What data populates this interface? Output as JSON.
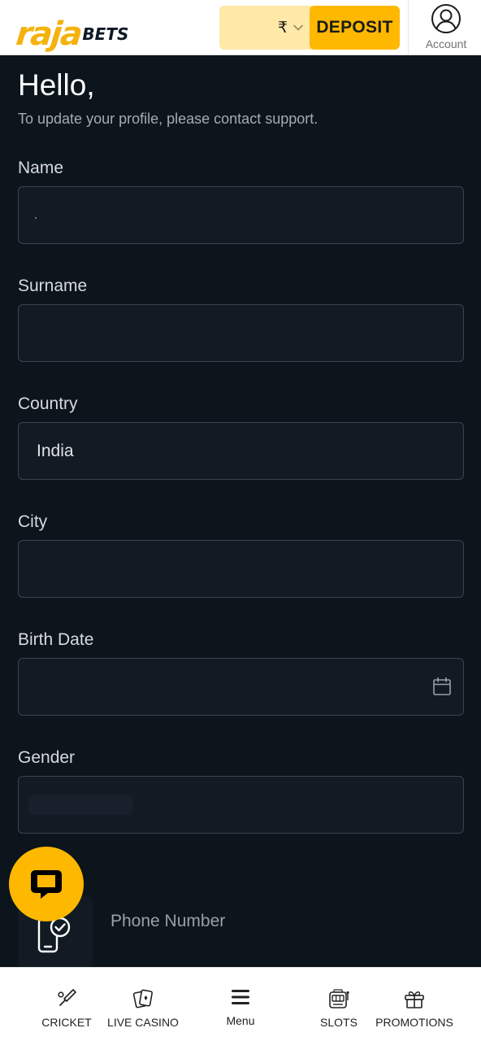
{
  "header": {
    "logo_primary": "raja",
    "logo_secondary": "BETS",
    "currency_symbol": "₹",
    "deposit_label": "DEPOSIT",
    "account_label": "Account"
  },
  "profile": {
    "greeting": "Hello,",
    "subtitle": "To update your profile, please contact support.",
    "fields": [
      {
        "label": "Name",
        "value": ""
      },
      {
        "label": "Surname",
        "value": ""
      },
      {
        "label": "Country",
        "value": "India"
      },
      {
        "label": "City",
        "value": ""
      },
      {
        "label": "Birth Date",
        "value": ""
      },
      {
        "label": "Gender",
        "value": ""
      }
    ],
    "phone_label": "Phone Number"
  },
  "bottom_nav": {
    "items": [
      {
        "label": "CRICKET",
        "icon": "cricket-bat-icon"
      },
      {
        "label": "LIVE CASINO",
        "icon": "playing-cards-icon"
      },
      {
        "label": "Menu",
        "icon": "hamburger-menu-icon"
      },
      {
        "label": "SLOTS",
        "icon": "slot-machine-icon"
      },
      {
        "label": "PROMOTIONS",
        "icon": "gift-icon"
      }
    ]
  },
  "colors": {
    "brand_yellow": "#ffb800",
    "background": "#0c141c",
    "field_background": "#121b24",
    "field_border": "#3a4450"
  }
}
